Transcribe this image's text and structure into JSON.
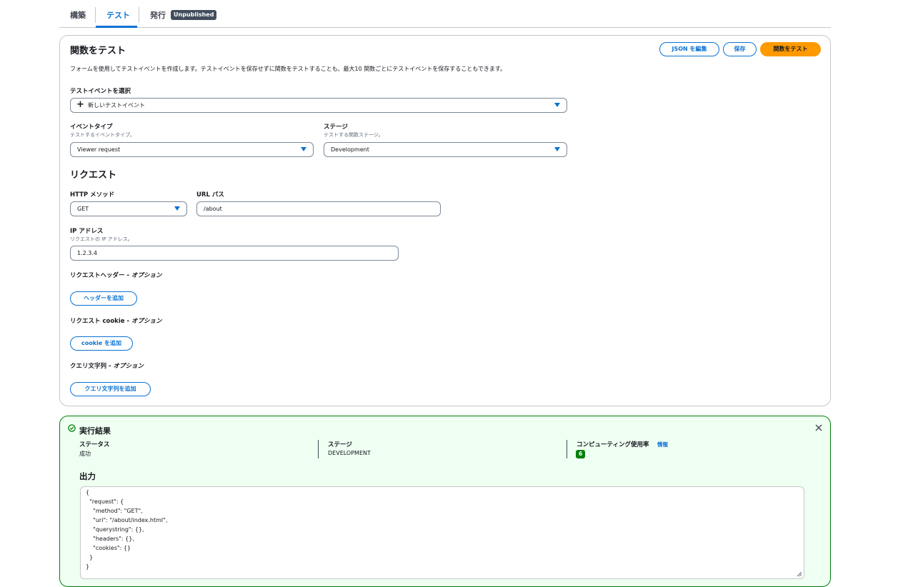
{
  "tabs": [
    {
      "label": "構築"
    },
    {
      "label": "テスト"
    },
    {
      "label": "発行",
      "badge": "Unpublished"
    }
  ],
  "panel": {
    "title": "関数をテスト",
    "description": "フォームを使用してテストイベントを作成します。テストイベントを保存せずに関数をテストすることも、最大10 関数ごとにテストイベントを保存することもできます。",
    "buttons": {
      "edit_json": "JSON を編集",
      "save": "保存",
      "test": "関数をテスト"
    },
    "select_event": {
      "label": "テストイベントを選択",
      "value": "新しいテストイベント"
    },
    "event_type": {
      "label": "イベントタイプ",
      "sublabel": "テストするイベントタイプ。",
      "value": "Viewer request"
    },
    "stage": {
      "label": "ステージ",
      "sublabel": "テストする関数ステージ。",
      "value": "Development"
    },
    "request_heading": "リクエスト",
    "http_method": {
      "label": "HTTP メソッド",
      "value": "GET"
    },
    "url_path": {
      "label": "URL パス",
      "value": "/about"
    },
    "ip": {
      "label": "IP アドレス",
      "sublabel": "リクエストの IP アドレス。",
      "value": "1.2.3.4"
    },
    "headers": {
      "label": "リクエストヘッダー - ",
      "optional": "オプション",
      "button": "ヘッダーを追加"
    },
    "cookies": {
      "label": "リクエスト cookie - ",
      "optional": "オプション",
      "button": "cookie を追加"
    },
    "query": {
      "label": "クエリ文字列 - ",
      "optional": "オプション",
      "button": "クエリ文字列を追加"
    }
  },
  "result": {
    "title": "実行結果",
    "status_label": "ステータス",
    "status_value": "成功",
    "stage_label": "ステージ",
    "stage_value": "DEVELOPMENT",
    "compute_label": "コンピューティング使用率",
    "compute_info": "情報",
    "compute_value": "6",
    "output_heading": "出力",
    "output_lines": [
      "{",
      "  \"request\": {",
      "    \"method\": \"GET\",",
      "    \"uri\": \"/about/index.html\",",
      "    \"querystring\": {},",
      "    \"headers\": {},",
      "    \"cookies\": {}",
      "  }",
      "}"
    ]
  },
  "colors": {
    "accent": "#0972d3",
    "primary": "#ff9900",
    "success": "#037f0c"
  },
  "icons": {
    "plus": "plus-icon",
    "caret": "caret-down-icon",
    "check": "check-circle-icon",
    "close": "close-icon"
  }
}
